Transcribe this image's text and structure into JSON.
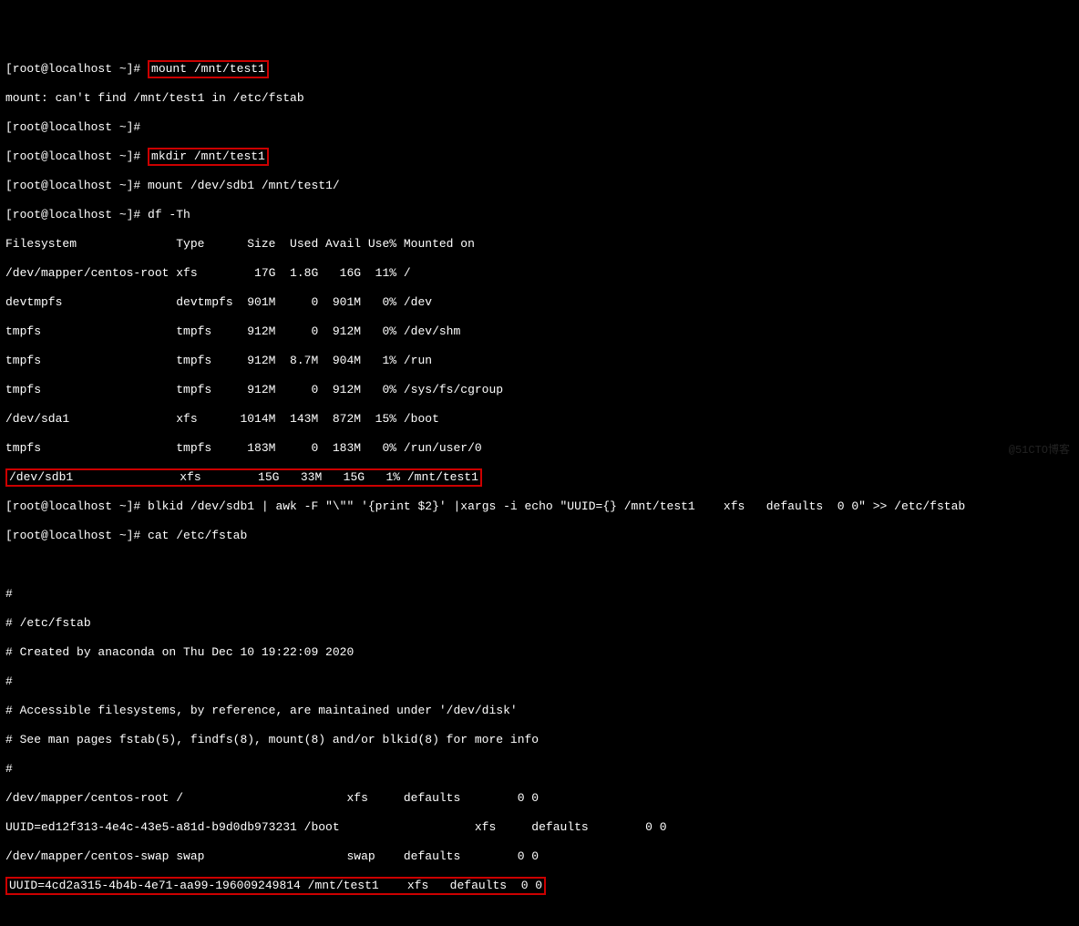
{
  "prompt": "[root@localhost ~]# ",
  "cmds": {
    "mount1": "mount /mnt/test1",
    "mkdir": "mkdir /mnt/test1",
    "mount2": "mount /dev/sdb1 /mnt/test1/",
    "df": "df -Th",
    "blkid": "blkid /dev/sdb1 | awk -F \"\\\"\" '{print $2}' |xargs -i echo \"UUID={} /mnt/test1    xfs   defaults  0 0\" >> /etc/fstab",
    "cat": "cat /etc/fstab"
  },
  "mount_err": "mount: can't find /mnt/test1 in /etc/fstab",
  "df_header": "Filesystem              Type      Size  Used Avail Use% Mounted on",
  "df_rows": [
    "/dev/mapper/centos-root xfs        17G  1.8G   16G  11% /",
    "devtmpfs                devtmpfs  901M     0  901M   0% /dev",
    "tmpfs                   tmpfs     912M     0  912M   0% /dev/shm",
    "tmpfs                   tmpfs     912M  8.7M  904M   1% /run",
    "tmpfs                   tmpfs     912M     0  912M   0% /sys/fs/cgroup",
    "/dev/sda1               xfs      1014M  143M  872M  15% /boot",
    "tmpfs                   tmpfs     183M     0  183M   0% /run/user/0"
  ],
  "df_hl": "/dev/sdb1               xfs        15G   33M   15G   1% /mnt/test1",
  "fstab": {
    "hash1": "#",
    "hash2": "# /etc/fstab",
    "created": "# Created by anaconda on Thu Dec 10 19:22:09 2020",
    "hash3": "#",
    "comment1": "# Accessible filesystems, by reference, are maintained under '/dev/disk'",
    "comment2": "# See man pages fstab(5), findfs(8), mount(8) and/or blkid(8) for more info",
    "hash4": "#",
    "l1": "/dev/mapper/centos-root /                       xfs     defaults        0 0",
    "l2": "UUID=ed12f313-4e4c-43e5-a81d-b9d0db973231 /boot                   xfs     defaults        0 0",
    "l3": "/dev/mapper/centos-swap swap                    swap    defaults        0 0",
    "hl": "UUID=4cd2a315-4b4b-4e71-aa99-196009249814 /mnt/test1    xfs   defaults  0 0"
  },
  "watermark": "@51CTO博客"
}
